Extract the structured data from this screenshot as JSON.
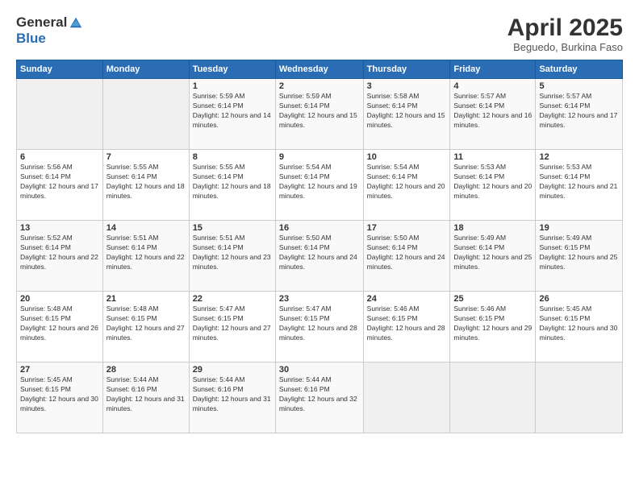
{
  "header": {
    "logo_general": "General",
    "logo_blue": "Blue",
    "title": "April 2025",
    "location": "Beguedo, Burkina Faso"
  },
  "calendar": {
    "days_of_week": [
      "Sunday",
      "Monday",
      "Tuesday",
      "Wednesday",
      "Thursday",
      "Friday",
      "Saturday"
    ],
    "weeks": [
      [
        {
          "day": "",
          "sunrise": "",
          "sunset": "",
          "daylight": ""
        },
        {
          "day": "",
          "sunrise": "",
          "sunset": "",
          "daylight": ""
        },
        {
          "day": "1",
          "sunrise": "Sunrise: 5:59 AM",
          "sunset": "Sunset: 6:14 PM",
          "daylight": "Daylight: 12 hours and 14 minutes."
        },
        {
          "day": "2",
          "sunrise": "Sunrise: 5:59 AM",
          "sunset": "Sunset: 6:14 PM",
          "daylight": "Daylight: 12 hours and 15 minutes."
        },
        {
          "day": "3",
          "sunrise": "Sunrise: 5:58 AM",
          "sunset": "Sunset: 6:14 PM",
          "daylight": "Daylight: 12 hours and 15 minutes."
        },
        {
          "day": "4",
          "sunrise": "Sunrise: 5:57 AM",
          "sunset": "Sunset: 6:14 PM",
          "daylight": "Daylight: 12 hours and 16 minutes."
        },
        {
          "day": "5",
          "sunrise": "Sunrise: 5:57 AM",
          "sunset": "Sunset: 6:14 PM",
          "daylight": "Daylight: 12 hours and 17 minutes."
        }
      ],
      [
        {
          "day": "6",
          "sunrise": "Sunrise: 5:56 AM",
          "sunset": "Sunset: 6:14 PM",
          "daylight": "Daylight: 12 hours and 17 minutes."
        },
        {
          "day": "7",
          "sunrise": "Sunrise: 5:55 AM",
          "sunset": "Sunset: 6:14 PM",
          "daylight": "Daylight: 12 hours and 18 minutes."
        },
        {
          "day": "8",
          "sunrise": "Sunrise: 5:55 AM",
          "sunset": "Sunset: 6:14 PM",
          "daylight": "Daylight: 12 hours and 18 minutes."
        },
        {
          "day": "9",
          "sunrise": "Sunrise: 5:54 AM",
          "sunset": "Sunset: 6:14 PM",
          "daylight": "Daylight: 12 hours and 19 minutes."
        },
        {
          "day": "10",
          "sunrise": "Sunrise: 5:54 AM",
          "sunset": "Sunset: 6:14 PM",
          "daylight": "Daylight: 12 hours and 20 minutes."
        },
        {
          "day": "11",
          "sunrise": "Sunrise: 5:53 AM",
          "sunset": "Sunset: 6:14 PM",
          "daylight": "Daylight: 12 hours and 20 minutes."
        },
        {
          "day": "12",
          "sunrise": "Sunrise: 5:53 AM",
          "sunset": "Sunset: 6:14 PM",
          "daylight": "Daylight: 12 hours and 21 minutes."
        }
      ],
      [
        {
          "day": "13",
          "sunrise": "Sunrise: 5:52 AM",
          "sunset": "Sunset: 6:14 PM",
          "daylight": "Daylight: 12 hours and 22 minutes."
        },
        {
          "day": "14",
          "sunrise": "Sunrise: 5:51 AM",
          "sunset": "Sunset: 6:14 PM",
          "daylight": "Daylight: 12 hours and 22 minutes."
        },
        {
          "day": "15",
          "sunrise": "Sunrise: 5:51 AM",
          "sunset": "Sunset: 6:14 PM",
          "daylight": "Daylight: 12 hours and 23 minutes."
        },
        {
          "day": "16",
          "sunrise": "Sunrise: 5:50 AM",
          "sunset": "Sunset: 6:14 PM",
          "daylight": "Daylight: 12 hours and 24 minutes."
        },
        {
          "day": "17",
          "sunrise": "Sunrise: 5:50 AM",
          "sunset": "Sunset: 6:14 PM",
          "daylight": "Daylight: 12 hours and 24 minutes."
        },
        {
          "day": "18",
          "sunrise": "Sunrise: 5:49 AM",
          "sunset": "Sunset: 6:14 PM",
          "daylight": "Daylight: 12 hours and 25 minutes."
        },
        {
          "day": "19",
          "sunrise": "Sunrise: 5:49 AM",
          "sunset": "Sunset: 6:15 PM",
          "daylight": "Daylight: 12 hours and 25 minutes."
        }
      ],
      [
        {
          "day": "20",
          "sunrise": "Sunrise: 5:48 AM",
          "sunset": "Sunset: 6:15 PM",
          "daylight": "Daylight: 12 hours and 26 minutes."
        },
        {
          "day": "21",
          "sunrise": "Sunrise: 5:48 AM",
          "sunset": "Sunset: 6:15 PM",
          "daylight": "Daylight: 12 hours and 27 minutes."
        },
        {
          "day": "22",
          "sunrise": "Sunrise: 5:47 AM",
          "sunset": "Sunset: 6:15 PM",
          "daylight": "Daylight: 12 hours and 27 minutes."
        },
        {
          "day": "23",
          "sunrise": "Sunrise: 5:47 AM",
          "sunset": "Sunset: 6:15 PM",
          "daylight": "Daylight: 12 hours and 28 minutes."
        },
        {
          "day": "24",
          "sunrise": "Sunrise: 5:46 AM",
          "sunset": "Sunset: 6:15 PM",
          "daylight": "Daylight: 12 hours and 28 minutes."
        },
        {
          "day": "25",
          "sunrise": "Sunrise: 5:46 AM",
          "sunset": "Sunset: 6:15 PM",
          "daylight": "Daylight: 12 hours and 29 minutes."
        },
        {
          "day": "26",
          "sunrise": "Sunrise: 5:45 AM",
          "sunset": "Sunset: 6:15 PM",
          "daylight": "Daylight: 12 hours and 30 minutes."
        }
      ],
      [
        {
          "day": "27",
          "sunrise": "Sunrise: 5:45 AM",
          "sunset": "Sunset: 6:15 PM",
          "daylight": "Daylight: 12 hours and 30 minutes."
        },
        {
          "day": "28",
          "sunrise": "Sunrise: 5:44 AM",
          "sunset": "Sunset: 6:16 PM",
          "daylight": "Daylight: 12 hours and 31 minutes."
        },
        {
          "day": "29",
          "sunrise": "Sunrise: 5:44 AM",
          "sunset": "Sunset: 6:16 PM",
          "daylight": "Daylight: 12 hours and 31 minutes."
        },
        {
          "day": "30",
          "sunrise": "Sunrise: 5:44 AM",
          "sunset": "Sunset: 6:16 PM",
          "daylight": "Daylight: 12 hours and 32 minutes."
        },
        {
          "day": "",
          "sunrise": "",
          "sunset": "",
          "daylight": ""
        },
        {
          "day": "",
          "sunrise": "",
          "sunset": "",
          "daylight": ""
        },
        {
          "day": "",
          "sunrise": "",
          "sunset": "",
          "daylight": ""
        }
      ]
    ]
  }
}
